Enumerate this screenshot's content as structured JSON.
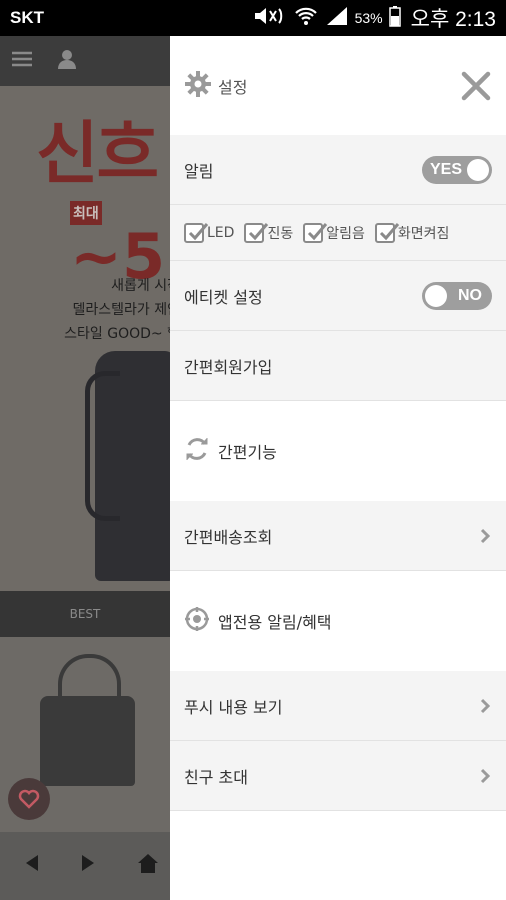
{
  "status_bar": {
    "carrier": "SKT",
    "battery": "53%",
    "time": "오후 2:13"
  },
  "background_app": {
    "banner_title": "신흐",
    "badge": "최대",
    "discount": "~5",
    "desc_lines": [
      "새롭게 시작",
      "델라스텔라가 제안",
      "스타일 GOOD~ 헬"
    ],
    "tab_label": "BEST"
  },
  "drawer": {
    "header_title": "설정",
    "notification": {
      "label": "알림",
      "toggle": "YES"
    },
    "checkboxes": [
      {
        "label": "LED"
      },
      {
        "label": "진동"
      },
      {
        "label": "알림음"
      },
      {
        "label": "화면켜짐"
      }
    ],
    "etiquette": {
      "label": "에티켓 설정",
      "toggle": "NO"
    },
    "signup": "간편회원가입",
    "quick_section": "간편기능",
    "delivery": "간편배송조회",
    "app_section": "앱전용 알림/혜택",
    "push_view": "푸시 내용 보기",
    "invite": "친구 초대"
  },
  "colors": {
    "toggle_bg": "#9e9e9e",
    "row_grey": "#f4f4f4",
    "icon_grey": "#9a9a9a"
  }
}
